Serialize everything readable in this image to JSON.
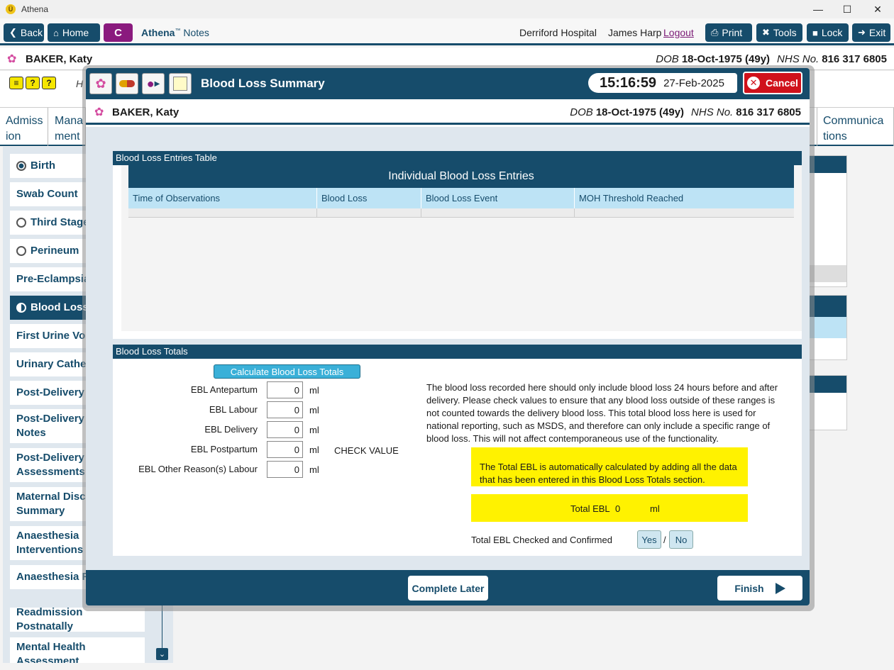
{
  "window": {
    "title": "Athena",
    "logo_glyph": "Ü"
  },
  "toolbar": {
    "back_label": "Back",
    "home_label": "Home",
    "c_label": "C",
    "app_brand": "Athena",
    "app_tm": "™",
    "app_suffix": "Notes",
    "hospital": "Derriford Hospital",
    "user": "James Harp",
    "logout_label": "Logout",
    "print_label": "Print",
    "tools_label": "Tools",
    "lock_label": "Lock",
    "exit_label": "Exit"
  },
  "patient": {
    "name": "BAKER, Katy",
    "dob_label": "DOB",
    "dob": "18-Oct-1975 (49y)",
    "nhs_label": "NHS No.",
    "nhs": "816 317 6805"
  },
  "subbar": {
    "h_text": "H"
  },
  "bg_tabs": [
    {
      "line1": "Admiss",
      "line2": "ion"
    },
    {
      "line1": "Mana",
      "line2": "ment"
    },
    {
      "line1": "Communica",
      "line2": "tions"
    }
  ],
  "left_nav": [
    {
      "label": "Birth",
      "radio": "filled"
    },
    {
      "label": "Swab Count"
    },
    {
      "label": "Third Stage",
      "radio": "empty"
    },
    {
      "label": "Perineum",
      "radio": "empty"
    },
    {
      "label": "Pre-Eclampsia"
    },
    {
      "label": "Blood Loss",
      "radio": "half",
      "active": true
    },
    {
      "label": "First Urine Voi"
    },
    {
      "label": "Urinary Cathe"
    },
    {
      "label": "Post-Delivery"
    },
    {
      "label": "Post-Delivery",
      "line2": "Notes"
    },
    {
      "label": "Post-Delivery",
      "line2": "Assessments"
    },
    {
      "label": "Maternal Disc",
      "line2": "Summary"
    },
    {
      "label": "Anaesthesia",
      "line2": "Interventions"
    },
    {
      "label": "Anaesthesia F"
    },
    {
      "label": "Readmission Postnatally"
    },
    {
      "label": "Mental Health",
      "line2": "Assessment"
    }
  ],
  "modal": {
    "title": "Blood Loss Summary",
    "time": "15:16:59",
    "date": "27-Feb-2025",
    "cancel_label": "Cancel",
    "entries_section_title": "Blood Loss Entries Table",
    "table_title": "Individual Blood Loss Entries",
    "columns": [
      "Time of Observations",
      "Blood Loss",
      "Blood Loss Event",
      "MOH Threshold Reached"
    ],
    "totals_section_title": "Blood Loss Totals",
    "calc_button": "Calculate Blood Loss Totals",
    "fields": [
      {
        "label": "EBL Antepartum",
        "value": "0",
        "unit": "ml"
      },
      {
        "label": "EBL Labour",
        "value": "0",
        "unit": "ml"
      },
      {
        "label": "EBL Delivery",
        "value": "0",
        "unit": "ml"
      },
      {
        "label": "EBL Postpartum",
        "value": "0",
        "unit": "ml",
        "note": "CHECK VALUE"
      },
      {
        "label": "EBL Other Reason(s) Labour",
        "value": "0",
        "unit": "ml"
      }
    ],
    "info_text": "The blood loss recorded here should only include blood loss 24 hours before and after delivery. Please check values to ensure that any blood loss outside of these ranges is not counted towards the delivery blood loss. This total blood loss here is used for national reporting, such as MSDS, and therefore can only include a specific range of blood loss. This will not affect contemporaneous use of the functionality.",
    "auto_calc_text": "The Total EBL is automatically calculated by adding all the data that has been entered in this Blood Loss Totals section.",
    "total_label": "Total EBL",
    "total_value": "0",
    "total_unit": "ml",
    "confirm_label": "Total EBL Checked and Confirmed",
    "yes_label": "Yes",
    "slash": "/",
    "no_label": "No",
    "complete_later_label": "Complete Later",
    "finish_label": "Finish"
  },
  "colors": {
    "primary": "#164c6b",
    "accent": "#8a1a7e",
    "cancel": "#d0111b",
    "highlight": "#fff200",
    "calc_button": "#3ab0d8"
  }
}
